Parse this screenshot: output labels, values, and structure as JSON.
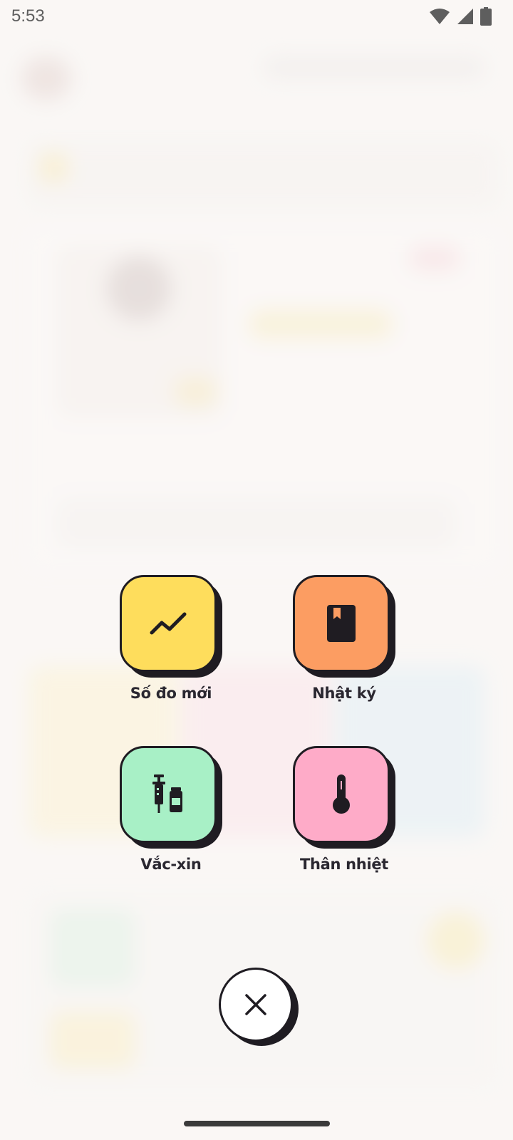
{
  "status_bar": {
    "time": "5:53"
  },
  "actions": [
    {
      "label": "Số đo mới",
      "icon": "trending-up-icon",
      "color": "#FEDD5C"
    },
    {
      "label": "Nhật ký",
      "icon": "book-icon",
      "color": "#FC9D62"
    },
    {
      "label": "Vắc-xin",
      "icon": "vaccine-icon",
      "color": "#A8F0C6"
    },
    {
      "label": "Thân nhiệt",
      "icon": "thermometer-icon",
      "color": "#FEABC8"
    }
  ],
  "close_button": {
    "icon": "close-icon"
  },
  "colors": {
    "outline": "#1F1C22",
    "background": "#F7F3F1"
  }
}
